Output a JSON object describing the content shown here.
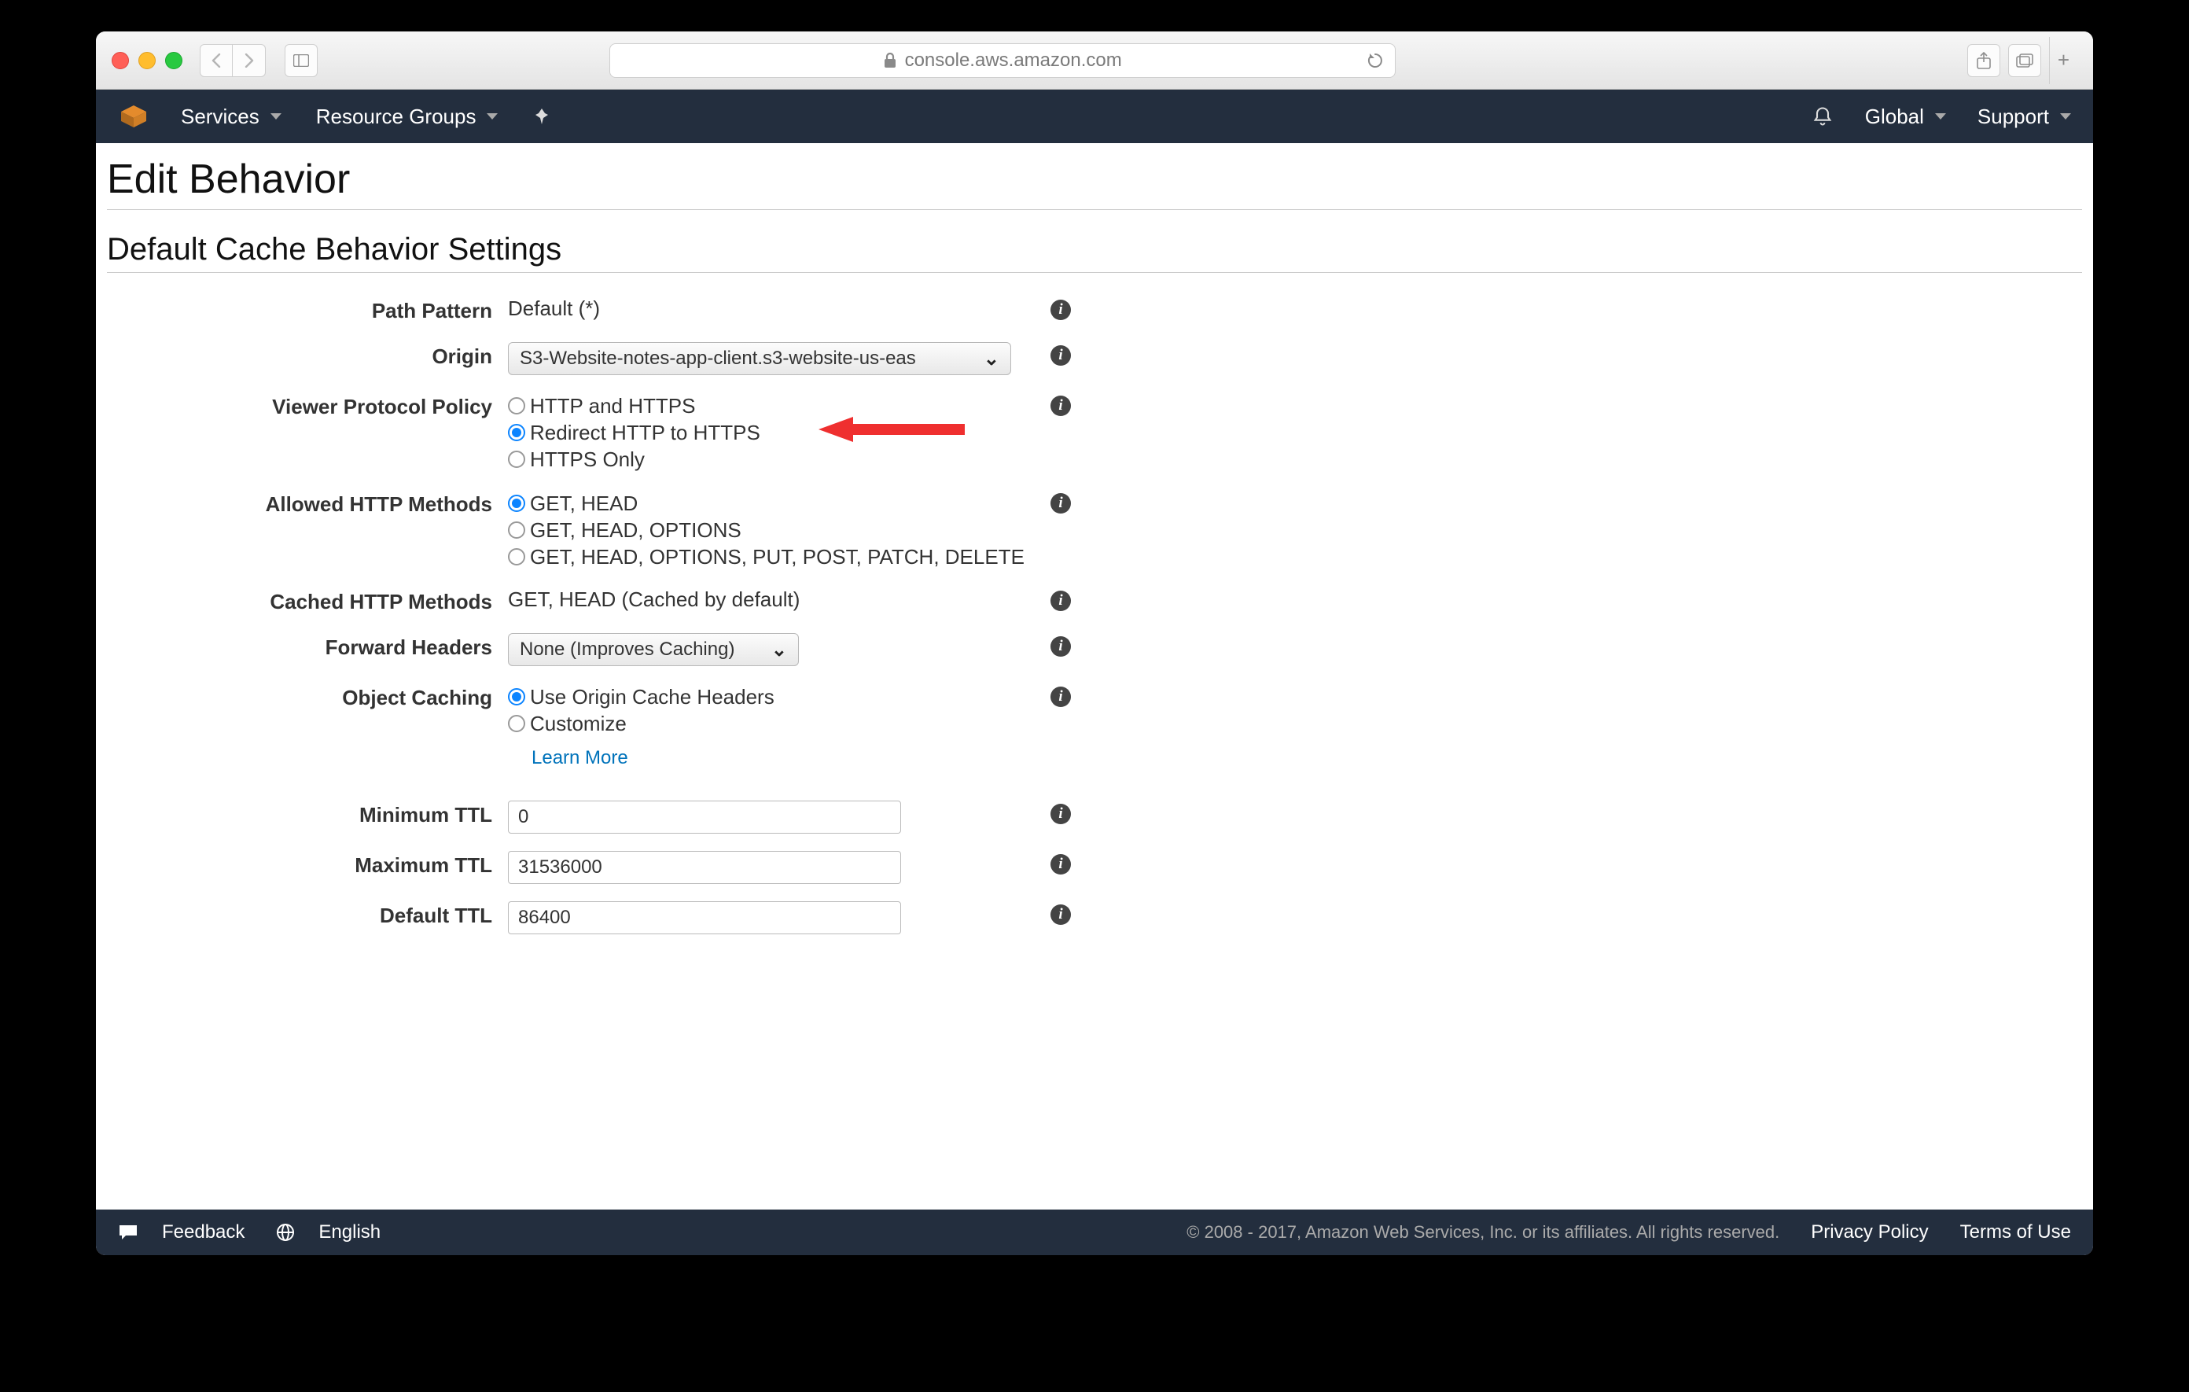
{
  "browser": {
    "url_host": "console.aws.amazon.com"
  },
  "nav": {
    "services": "Services",
    "resource_groups": "Resource Groups",
    "region": "Global",
    "support": "Support"
  },
  "page": {
    "title": "Edit Behavior",
    "section": "Default Cache Behavior Settings"
  },
  "form": {
    "path_pattern": {
      "label": "Path Pattern",
      "value": "Default (*)"
    },
    "origin": {
      "label": "Origin",
      "selected": "S3-Website-notes-app-client.s3-website-us-eas"
    },
    "viewer_protocol": {
      "label": "Viewer Protocol Policy",
      "options": [
        "HTTP and HTTPS",
        "Redirect HTTP to HTTPS",
        "HTTPS Only"
      ],
      "selected_index": 1
    },
    "allowed_methods": {
      "label": "Allowed HTTP Methods",
      "options": [
        "GET, HEAD",
        "GET, HEAD, OPTIONS",
        "GET, HEAD, OPTIONS, PUT, POST, PATCH, DELETE"
      ],
      "selected_index": 0
    },
    "cached_methods": {
      "label": "Cached HTTP Methods",
      "value": "GET, HEAD (Cached by default)"
    },
    "forward_headers": {
      "label": "Forward Headers",
      "selected": "None (Improves Caching)"
    },
    "object_caching": {
      "label": "Object Caching",
      "options": [
        "Use Origin Cache Headers",
        "Customize"
      ],
      "selected_index": 0,
      "learn_more": "Learn More"
    },
    "min_ttl": {
      "label": "Minimum TTL",
      "value": "0"
    },
    "max_ttl": {
      "label": "Maximum TTL",
      "value": "31536000"
    },
    "default_ttl": {
      "label": "Default TTL",
      "value": "86400"
    }
  },
  "footer": {
    "feedback": "Feedback",
    "language": "English",
    "copyright": "© 2008 - 2017, Amazon Web Services, Inc. or its affiliates. All rights reserved.",
    "privacy": "Privacy Policy",
    "terms": "Terms of Use"
  }
}
